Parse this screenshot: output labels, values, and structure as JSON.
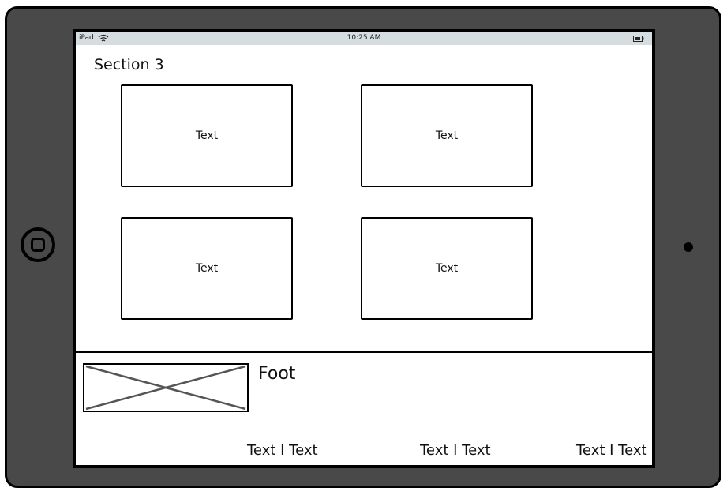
{
  "status_bar": {
    "device": "iPad",
    "time": "10:25 AM",
    "wifi_icon": "wifi-icon",
    "battery_icon": "battery-icon"
  },
  "section": {
    "title": "Section 3",
    "cards": [
      {
        "label": "Text"
      },
      {
        "label": "Text"
      },
      {
        "label": "Text"
      },
      {
        "label": "Text"
      }
    ]
  },
  "footer": {
    "title": "Foot",
    "image_icon": "image-placeholder-icon",
    "links": [
      {
        "label": "Text I Text"
      },
      {
        "label": "Text I Text"
      },
      {
        "label": "Text I Text"
      }
    ]
  },
  "colors": {
    "frame": "#494949",
    "status_bar": "#d6dde0",
    "outline": "#000000"
  }
}
